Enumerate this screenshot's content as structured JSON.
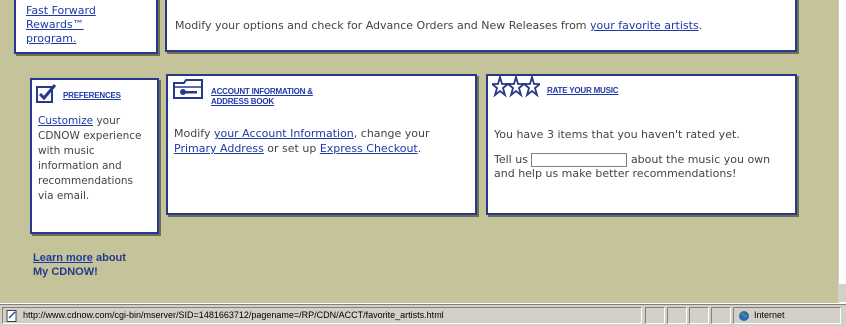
{
  "top_left_box": {
    "line1": "Fast Forward",
    "line2": "Rewards™",
    "line3": "program."
  },
  "top_wide_box": {
    "text": "Modify your options and check for Advance Orders and New Releases from ",
    "link": "your favorite artists",
    "end": "."
  },
  "preferences": {
    "title": "PREFERENCES",
    "link": "Customize",
    "text_after": " your CDNOW experience with music information and recommendations via email."
  },
  "account": {
    "title_line1": "ACCOUNT INFORMATION &",
    "title_line2": "ADDRESS BOOK",
    "t1": "Modify ",
    "link1": "your Account Information",
    "t2": ", change your ",
    "link2": "Primary Address",
    "t3": " or set up ",
    "link3": "Express Checkout",
    "t4": "."
  },
  "rate": {
    "title": "RATE YOUR MUSIC",
    "line1": "You have 3 items that you haven't rated yet.",
    "tell_us": "Tell us",
    "input_value": "",
    "after_input": " about the music you own and help us make better recommendations!"
  },
  "learn_more": {
    "link": "Learn more",
    "after": " about",
    "line2": "My CDNOW!"
  },
  "status_bar": {
    "url": "http://www.cdnow.com/cgi-bin/mserver/SID=1481663712/pagename=/RP/CDN/ACCT/favorite_artists.html",
    "zone": "Internet"
  },
  "colors": {
    "page_bg": "#c5c39a",
    "box_border": "#26398b",
    "link": "#1f3aa6"
  }
}
